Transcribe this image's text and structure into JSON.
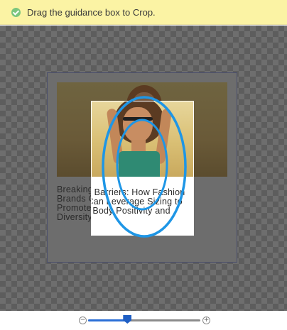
{
  "banner": {
    "icon": "checkmark-circle-icon",
    "message": "Drag the guidance box to Crop."
  },
  "card": {
    "headline": "Breaking Barriers: How Fashion Brands Can Leverage Sizing to Promote Body Positivity and Diversity"
  },
  "zoom": {
    "minus_icon": "zoom-out-icon",
    "plus_icon": "zoom-in-icon",
    "minus_glyph": "−",
    "plus_glyph": "+",
    "level": 0.35
  },
  "colors": {
    "banner_bg": "#fbf3a4",
    "annotation_blue": "#1e96e6",
    "zoom_accent": "#1f5fc4"
  }
}
